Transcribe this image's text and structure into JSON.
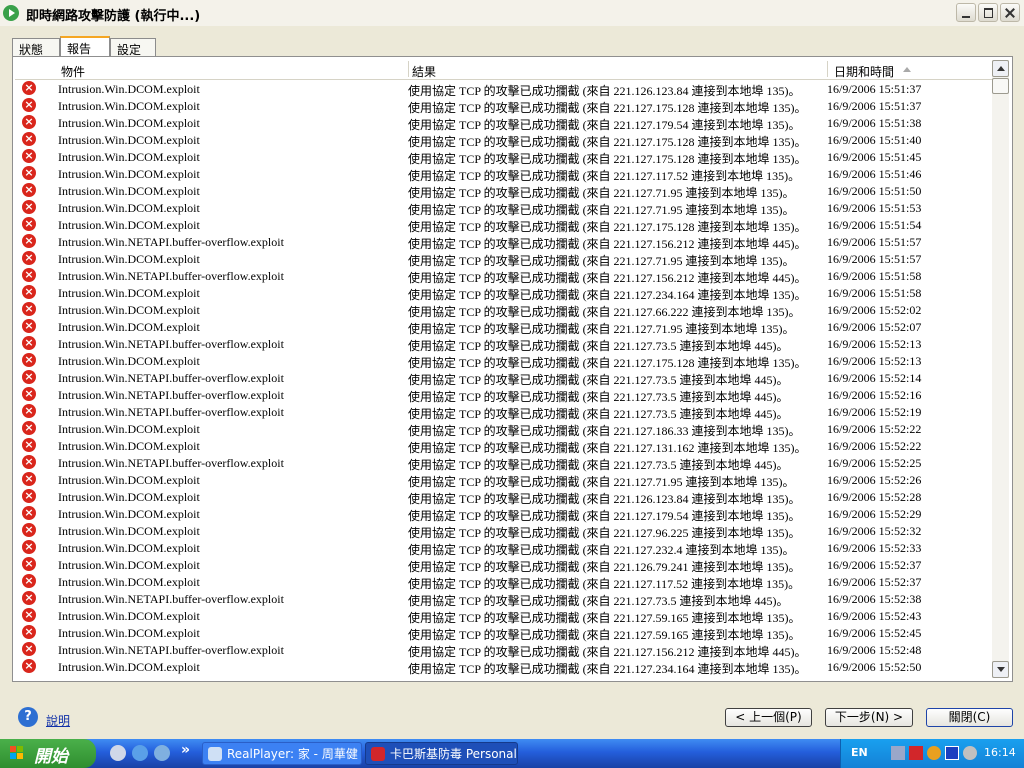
{
  "window": {
    "title": "即時網路攻擊防護 (執行中...)"
  },
  "tabs": [
    {
      "label": "狀態"
    },
    {
      "label": "報告"
    },
    {
      "label": "設定"
    }
  ],
  "columns": {
    "object": "物件",
    "result": "結果",
    "datetime": "日期和時間"
  },
  "rows": [
    {
      "object": "Intrusion.Win.DCOM.exploit",
      "result": "使用協定 TCP 的攻擊已成功攔截 (來自 221.126.123.84 連接到本地埠 135)。",
      "time": "16/9/2006 15:51:37"
    },
    {
      "object": "Intrusion.Win.DCOM.exploit",
      "result": "使用協定 TCP 的攻擊已成功攔截 (來自 221.127.175.128 連接到本地埠 135)。",
      "time": "16/9/2006 15:51:37"
    },
    {
      "object": "Intrusion.Win.DCOM.exploit",
      "result": "使用協定 TCP 的攻擊已成功攔截 (來自 221.127.179.54 連接到本地埠 135)。",
      "time": "16/9/2006 15:51:38"
    },
    {
      "object": "Intrusion.Win.DCOM.exploit",
      "result": "使用協定 TCP 的攻擊已成功攔截 (來自 221.127.175.128 連接到本地埠 135)。",
      "time": "16/9/2006 15:51:40"
    },
    {
      "object": "Intrusion.Win.DCOM.exploit",
      "result": "使用協定 TCP 的攻擊已成功攔截 (來自 221.127.175.128 連接到本地埠 135)。",
      "time": "16/9/2006 15:51:45"
    },
    {
      "object": "Intrusion.Win.DCOM.exploit",
      "result": "使用協定 TCP 的攻擊已成功攔截 (來自 221.127.117.52 連接到本地埠 135)。",
      "time": "16/9/2006 15:51:46"
    },
    {
      "object": "Intrusion.Win.DCOM.exploit",
      "result": "使用協定 TCP 的攻擊已成功攔截 (來自 221.127.71.95 連接到本地埠 135)。",
      "time": "16/9/2006 15:51:50"
    },
    {
      "object": "Intrusion.Win.DCOM.exploit",
      "result": "使用協定 TCP 的攻擊已成功攔截 (來自 221.127.71.95 連接到本地埠 135)。",
      "time": "16/9/2006 15:51:53"
    },
    {
      "object": "Intrusion.Win.DCOM.exploit",
      "result": "使用協定 TCP 的攻擊已成功攔截 (來自 221.127.175.128 連接到本地埠 135)。",
      "time": "16/9/2006 15:51:54"
    },
    {
      "object": "Intrusion.Win.NETAPI.buffer-overflow.exploit",
      "result": "使用協定 TCP 的攻擊已成功攔截 (來自 221.127.156.212 連接到本地埠 445)。",
      "time": "16/9/2006 15:51:57"
    },
    {
      "object": "Intrusion.Win.DCOM.exploit",
      "result": "使用協定 TCP 的攻擊已成功攔截 (來自 221.127.71.95 連接到本地埠 135)。",
      "time": "16/9/2006 15:51:57"
    },
    {
      "object": "Intrusion.Win.NETAPI.buffer-overflow.exploit",
      "result": "使用協定 TCP 的攻擊已成功攔截 (來自 221.127.156.212 連接到本地埠 445)。",
      "time": "16/9/2006 15:51:58"
    },
    {
      "object": "Intrusion.Win.DCOM.exploit",
      "result": "使用協定 TCP 的攻擊已成功攔截 (來自 221.127.234.164 連接到本地埠 135)。",
      "time": "16/9/2006 15:51:58"
    },
    {
      "object": "Intrusion.Win.DCOM.exploit",
      "result": "使用協定 TCP 的攻擊已成功攔截 (來自 221.127.66.222 連接到本地埠 135)。",
      "time": "16/9/2006 15:52:02"
    },
    {
      "object": "Intrusion.Win.DCOM.exploit",
      "result": "使用協定 TCP 的攻擊已成功攔截 (來自 221.127.71.95 連接到本地埠 135)。",
      "time": "16/9/2006 15:52:07"
    },
    {
      "object": "Intrusion.Win.NETAPI.buffer-overflow.exploit",
      "result": "使用協定 TCP 的攻擊已成功攔截 (來自 221.127.73.5 連接到本地埠 445)。",
      "time": "16/9/2006 15:52:13"
    },
    {
      "object": "Intrusion.Win.DCOM.exploit",
      "result": "使用協定 TCP 的攻擊已成功攔截 (來自 221.127.175.128 連接到本地埠 135)。",
      "time": "16/9/2006 15:52:13"
    },
    {
      "object": "Intrusion.Win.NETAPI.buffer-overflow.exploit",
      "result": "使用協定 TCP 的攻擊已成功攔截 (來自 221.127.73.5 連接到本地埠 445)。",
      "time": "16/9/2006 15:52:14"
    },
    {
      "object": "Intrusion.Win.NETAPI.buffer-overflow.exploit",
      "result": "使用協定 TCP 的攻擊已成功攔截 (來自 221.127.73.5 連接到本地埠 445)。",
      "time": "16/9/2006 15:52:16"
    },
    {
      "object": "Intrusion.Win.NETAPI.buffer-overflow.exploit",
      "result": "使用協定 TCP 的攻擊已成功攔截 (來自 221.127.73.5 連接到本地埠 445)。",
      "time": "16/9/2006 15:52:19"
    },
    {
      "object": "Intrusion.Win.DCOM.exploit",
      "result": "使用協定 TCP 的攻擊已成功攔截 (來自 221.127.186.33 連接到本地埠 135)。",
      "time": "16/9/2006 15:52:22"
    },
    {
      "object": "Intrusion.Win.DCOM.exploit",
      "result": "使用協定 TCP 的攻擊已成功攔截 (來自 221.127.131.162 連接到本地埠 135)。",
      "time": "16/9/2006 15:52:22"
    },
    {
      "object": "Intrusion.Win.NETAPI.buffer-overflow.exploit",
      "result": "使用協定 TCP 的攻擊已成功攔截 (來自 221.127.73.5 連接到本地埠 445)。",
      "time": "16/9/2006 15:52:25"
    },
    {
      "object": "Intrusion.Win.DCOM.exploit",
      "result": "使用協定 TCP 的攻擊已成功攔截 (來自 221.127.71.95 連接到本地埠 135)。",
      "time": "16/9/2006 15:52:26"
    },
    {
      "object": "Intrusion.Win.DCOM.exploit",
      "result": "使用協定 TCP 的攻擊已成功攔截 (來自 221.126.123.84 連接到本地埠 135)。",
      "time": "16/9/2006 15:52:28"
    },
    {
      "object": "Intrusion.Win.DCOM.exploit",
      "result": "使用協定 TCP 的攻擊已成功攔截 (來自 221.127.179.54 連接到本地埠 135)。",
      "time": "16/9/2006 15:52:29"
    },
    {
      "object": "Intrusion.Win.DCOM.exploit",
      "result": "使用協定 TCP 的攻擊已成功攔截 (來自 221.127.96.225 連接到本地埠 135)。",
      "time": "16/9/2006 15:52:32"
    },
    {
      "object": "Intrusion.Win.DCOM.exploit",
      "result": "使用協定 TCP 的攻擊已成功攔截 (來自 221.127.232.4 連接到本地埠 135)。",
      "time": "16/9/2006 15:52:33"
    },
    {
      "object": "Intrusion.Win.DCOM.exploit",
      "result": "使用協定 TCP 的攻擊已成功攔截 (來自 221.126.79.241 連接到本地埠 135)。",
      "time": "16/9/2006 15:52:37"
    },
    {
      "object": "Intrusion.Win.DCOM.exploit",
      "result": "使用協定 TCP 的攻擊已成功攔截 (來自 221.127.117.52 連接到本地埠 135)。",
      "time": "16/9/2006 15:52:37"
    },
    {
      "object": "Intrusion.Win.NETAPI.buffer-overflow.exploit",
      "result": "使用協定 TCP 的攻擊已成功攔截 (來自 221.127.73.5 連接到本地埠 445)。",
      "time": "16/9/2006 15:52:38"
    },
    {
      "object": "Intrusion.Win.DCOM.exploit",
      "result": "使用協定 TCP 的攻擊已成功攔截 (來自 221.127.59.165 連接到本地埠 135)。",
      "time": "16/9/2006 15:52:43"
    },
    {
      "object": "Intrusion.Win.DCOM.exploit",
      "result": "使用協定 TCP 的攻擊已成功攔截 (來自 221.127.59.165 連接到本地埠 135)。",
      "time": "16/9/2006 15:52:45"
    },
    {
      "object": "Intrusion.Win.NETAPI.buffer-overflow.exploit",
      "result": "使用協定 TCP 的攻擊已成功攔截 (來自 221.127.156.212 連接到本地埠 445)。",
      "time": "16/9/2006 15:52:48"
    },
    {
      "object": "Intrusion.Win.DCOM.exploit",
      "result": "使用協定 TCP 的攻擊已成功攔截 (來自 221.127.234.164 連接到本地埠 135)。",
      "time": "16/9/2006 15:52:50"
    }
  ],
  "footer": {
    "help_label": "說明",
    "prev_label": "< 上一個(P)",
    "next_label": "下一步(N) >",
    "close_label": "關閉(C)"
  },
  "taskbar": {
    "start_label": "開始",
    "quicklaunch_more": "»",
    "tasks": [
      {
        "label": "RealPlayer: 家 - 周華健"
      },
      {
        "label": "卡巴斯基防毒 Personal"
      }
    ],
    "lang": "EN",
    "clock": "16:14"
  },
  "colors": {
    "error": "#d9261c",
    "taskbar": "#245edb",
    "start": "#3c9b3c",
    "tray": "#1596e6"
  }
}
